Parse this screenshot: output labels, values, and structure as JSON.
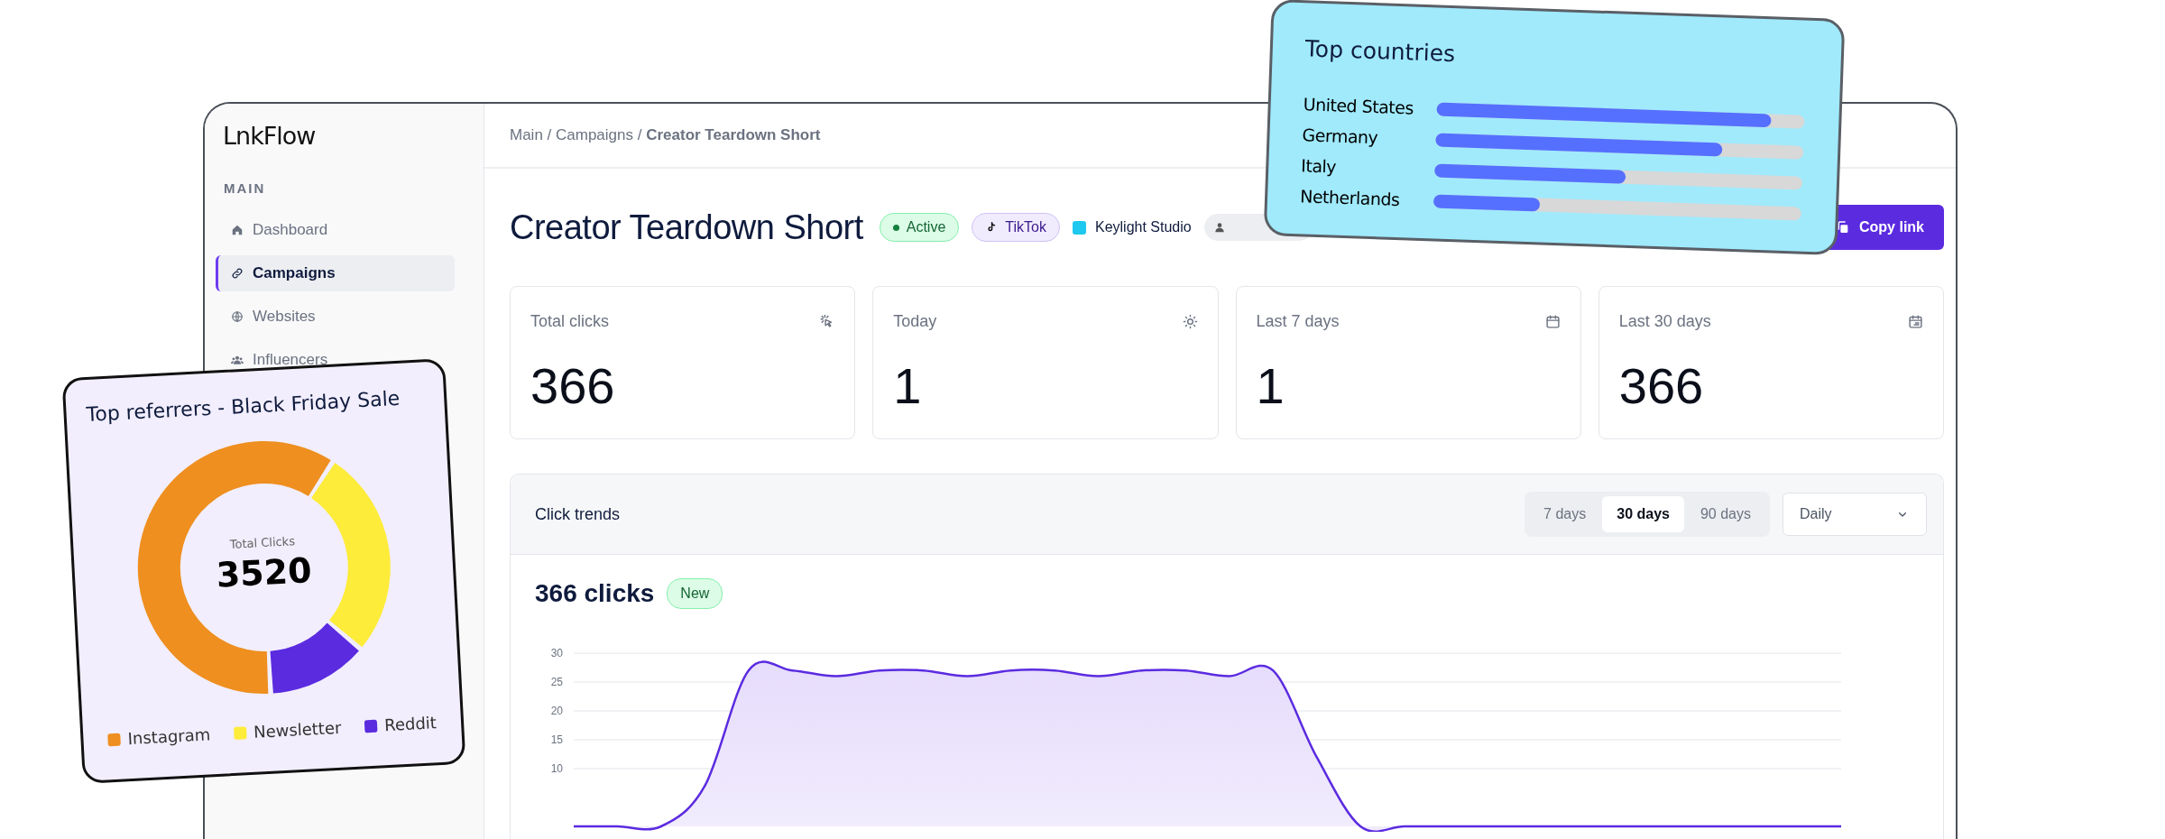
{
  "sidebar": {
    "logo": "LnkFlow",
    "section": "MAIN",
    "items": [
      {
        "label": "Dashboard",
        "selected": false
      },
      {
        "label": "Campaigns",
        "selected": true
      },
      {
        "label": "Websites",
        "selected": false
      },
      {
        "label": "Influencers",
        "selected": false
      }
    ]
  },
  "breadcrumb": "Main / Campaigns / **Creator Teardown Short**",
  "header": {
    "title": "Creator Teardown Short",
    "badges": [
      {
        "kind": "status",
        "label": "Active"
      },
      {
        "kind": "platform",
        "label": "TikTok"
      },
      {
        "kind": "brand",
        "label": "Keylight Studio",
        "color": "#1ec8ef"
      },
      {
        "kind": "owner"
      }
    ],
    "button": "Copy link"
  },
  "stats": [
    {
      "label": "Total clicks",
      "value": "366"
    },
    {
      "label": "Today",
      "value": "1"
    },
    {
      "label": "Last 7 days",
      "value": "1"
    },
    {
      "label": "Last 30 days",
      "value": "366"
    }
  ],
  "trends": {
    "title": "Click trends",
    "ranges": [
      {
        "label": "7 days",
        "selected": false
      },
      {
        "label": "30 days",
        "selected": true
      },
      {
        "label": "90 days",
        "selected": false
      }
    ],
    "interval": "Daily",
    "total": "366 clicks",
    "badge": "New",
    "chart_data": {
      "type": "area",
      "grid": true,
      "ylim": [
        0,
        30
      ],
      "yticks": [
        10,
        15,
        20,
        25,
        30
      ],
      "series": [
        {
          "color": "#5b2be0",
          "values": [
            0,
            0,
            0,
            7,
            27,
            27,
            26,
            27,
            27,
            26,
            27,
            27,
            26,
            27,
            27,
            26,
            27,
            12,
            0,
            0,
            0,
            0,
            0,
            0,
            0,
            0,
            0,
            0,
            0,
            0
          ]
        }
      ]
    }
  },
  "top_countries": {
    "title": "Top countries",
    "rows": [
      {
        "label": "United States",
        "level": 0.91
      },
      {
        "label": "Germany",
        "level": 0.78
      },
      {
        "label": "Italy",
        "level": 0.52
      },
      {
        "label": "Netherlands",
        "level": 0.29
      }
    ]
  },
  "top_referrers": {
    "title": "Top referrers - Black Friday Sale",
    "center_label": "Total Clicks",
    "center_value": "3520",
    "legend": [
      {
        "label": "Instagram",
        "color": "#ee8f1f"
      },
      {
        "label": "Newsletter",
        "color": "#fdec39"
      },
      {
        "label": "Reddit",
        "color": "#5b2be0"
      }
    ]
  }
}
